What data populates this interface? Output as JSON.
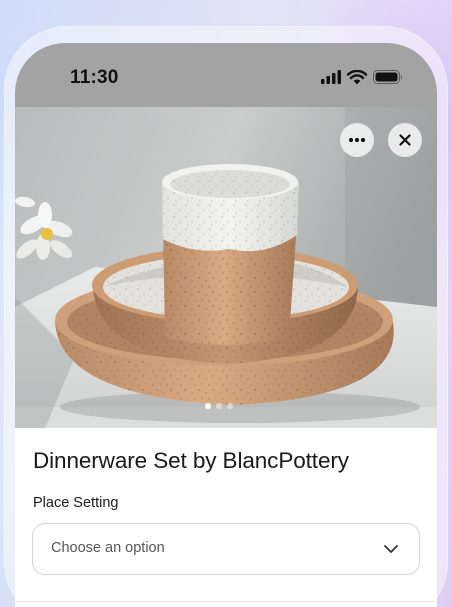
{
  "status_bar": {
    "time": "11:30",
    "icons": [
      "signal-icon",
      "wifi-icon",
      "battery-icon"
    ]
  },
  "image": {
    "subject": "ceramic-dinnerware-photo",
    "action_icons": [
      "more-icon",
      "close-icon"
    ],
    "carousel": {
      "count": 3,
      "active_index": 0
    }
  },
  "product": {
    "title": "Dinnerware Set by BlancPottery",
    "option_label": "Place Setting",
    "option_value": "Choose an option"
  },
  "colors": {
    "status_bar_bg": "#a3a3a3",
    "text_primary": "#1a1a1a",
    "select_border": "#d5d5d5"
  }
}
